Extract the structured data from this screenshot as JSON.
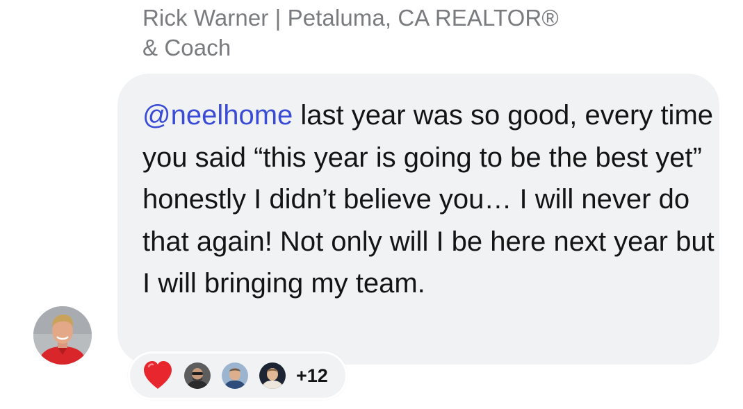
{
  "comment": {
    "author_line1": "Rick Warner | Petaluma, CA REALTOR®",
    "author_line2": "& Coach",
    "mention": "@neelhome",
    "text": " last year was so good, every time you said “this year is going to be the best yet” honestly I didn’t believe you… I will never do that again! Not only will I be here next year but I will bringing my team."
  },
  "reactions": {
    "emoji": "heart-icon",
    "more_count": "+12"
  },
  "colors": {
    "mention": "#3a4cd6",
    "bubble": "#f1f2f4",
    "author": "#7a7b7e",
    "heart": "#e8262d"
  }
}
